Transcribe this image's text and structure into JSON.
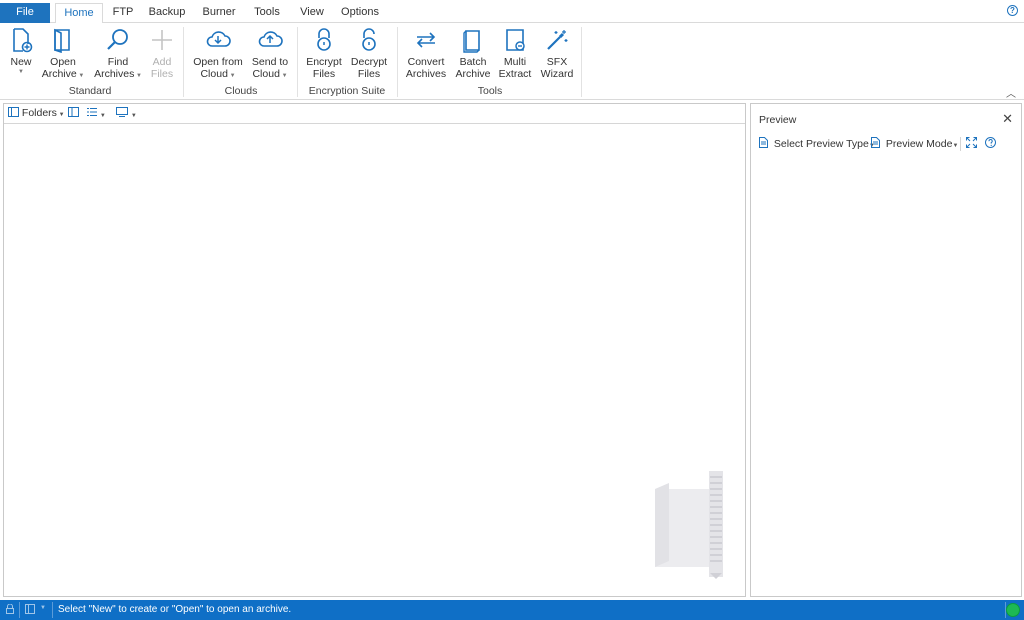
{
  "tabs": {
    "file": "File",
    "items": [
      "Home",
      "FTP",
      "Backup",
      "Burner",
      "Tools",
      "View",
      "Options"
    ]
  },
  "ribbon": {
    "standard": {
      "label": "Standard",
      "new": [
        "New",
        ""
      ],
      "open": [
        "Open",
        "Archive"
      ],
      "find": [
        "Find",
        "Archives"
      ],
      "add": [
        "Add",
        "Files"
      ]
    },
    "clouds": {
      "label": "Clouds",
      "open_cloud": [
        "Open from",
        "Cloud"
      ],
      "send_cloud": [
        "Send to",
        "Cloud"
      ]
    },
    "encryption": {
      "label": "Encryption Suite",
      "encrypt": [
        "Encrypt",
        "Files"
      ],
      "decrypt": [
        "Decrypt",
        "Files"
      ]
    },
    "tools": {
      "label": "Tools",
      "convert": [
        "Convert",
        "Archives"
      ],
      "batch": [
        "Batch",
        "Archive"
      ],
      "multi": [
        "Multi",
        "Extract"
      ],
      "sfx": [
        "SFX",
        "Wizard"
      ]
    }
  },
  "left_toolbar": {
    "folders": "Folders"
  },
  "preview": {
    "title": "Preview",
    "select_type": "Select Preview Type",
    "mode": "Preview Mode"
  },
  "status": {
    "message": "Select \"New\" to create or \"Open\" to open an archive."
  },
  "colors": {
    "accent": "#1e73be",
    "status_bar": "#0f6fc6",
    "status_indicator": "#1db954"
  }
}
